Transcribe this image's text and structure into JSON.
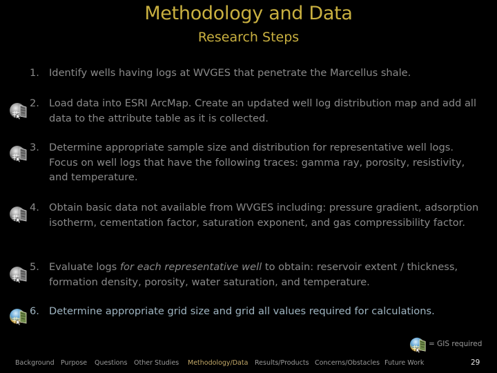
{
  "slide": {
    "title": "Methodology and Data",
    "subtitle": "Research Steps",
    "page_number": "29"
  },
  "steps": [
    {
      "num": "1.",
      "gis_required": false,
      "text": "Identify wells having logs at WVGES that penetrate the Marcellus shale."
    },
    {
      "num": "2.",
      "gis_required": true,
      "text": "Load data into ESRI ArcMap.  Create an updated well log distribution map and add all data to the attribute table as it is collected."
    },
    {
      "num": "3.",
      "gis_required": true,
      "text": "Determine appropriate sample size and distribution for representative well logs.  Focus on well logs that have the following traces:  gamma ray, porosity, resistivity, and temperature."
    },
    {
      "num": "4.",
      "gis_required": true,
      "text": "Obtain basic data not available from WVGES including:  pressure gradient, adsorption isotherm, cementation factor, saturation exponent, and gas compressibility factor."
    },
    {
      "num": "5.",
      "gis_required": true,
      "text_before": "Evaluate logs ",
      "text_italic": "for each representative well",
      "text_after": " to obtain:  reservoir extent / thickness, formation density, porosity, water saturation, and temperature."
    },
    {
      "num": "6.",
      "gis_required": true,
      "active": true,
      "text": "Determine appropriate grid size and grid all values required for calculations."
    }
  ],
  "legend": {
    "icon": "gis-globe-map-icon",
    "text": "= GIS required"
  },
  "nav": {
    "items": [
      {
        "label": "Background"
      },
      {
        "label": "Purpose"
      },
      {
        "label": "Questions"
      },
      {
        "label": "Other Studies"
      },
      {
        "label": "Methodology/Data",
        "current": true
      },
      {
        "label": "Results/Products"
      },
      {
        "label": "Concerns/Obstacles"
      },
      {
        "label": "Future Work"
      }
    ]
  },
  "colors": {
    "title": "#c9b040",
    "body_text": "#8a8a8a",
    "active_text": "#9fb5c2",
    "nav_text": "#9a9a9a",
    "nav_current": "#c2a868",
    "background": "#000000"
  }
}
